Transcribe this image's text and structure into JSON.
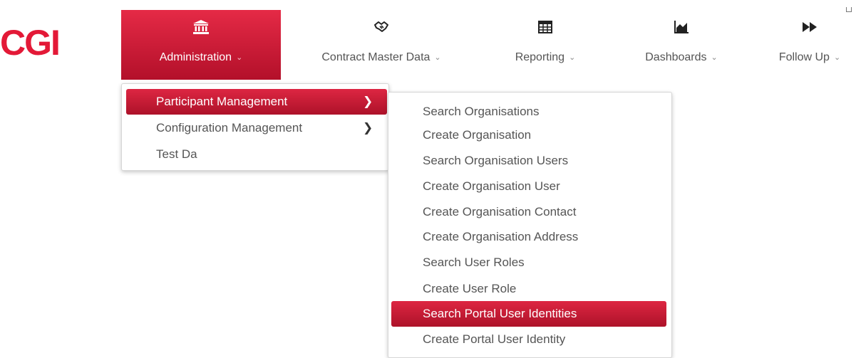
{
  "brand": {
    "logo_text": "CGI",
    "color": "#e31937"
  },
  "accent_color": "#c41e3a",
  "nav": {
    "items": [
      {
        "id": "administration",
        "label": "Administration",
        "icon": "bank-icon",
        "active": true
      },
      {
        "id": "contract-master-data",
        "label": "Contract Master Data",
        "icon": "handshake-icon",
        "active": false
      },
      {
        "id": "reporting",
        "label": "Reporting",
        "icon": "table-grid-icon",
        "active": false
      },
      {
        "id": "dashboards",
        "label": "Dashboards",
        "icon": "area-chart-icon",
        "active": false
      },
      {
        "id": "follow-up",
        "label": "Follow Up",
        "icon": "fast-forward-icon",
        "active": false
      }
    ],
    "caret_glyph": "⌄"
  },
  "menu_level1": {
    "items": [
      {
        "label": "Participant Management",
        "has_submenu": true,
        "active": true
      },
      {
        "label": "Configuration Management",
        "has_submenu": true,
        "active": false
      },
      {
        "label": "Test Da",
        "has_submenu": false,
        "active": false
      }
    ],
    "chevron_glyph": "❯"
  },
  "menu_level2": {
    "items": [
      {
        "label": "Search Organisations",
        "active": false
      },
      {
        "label": "Create Organisation",
        "active": false
      },
      {
        "label": "Search Organisation Users",
        "active": false
      },
      {
        "label": "Create Organisation User",
        "active": false
      },
      {
        "label": "Create Organisation Contact",
        "active": false
      },
      {
        "label": "Create Organisation Address",
        "active": false
      },
      {
        "label": "Search User Roles",
        "active": false
      },
      {
        "label": "Create User Role",
        "active": false
      },
      {
        "label": "Search Portal User Identities",
        "active": true
      },
      {
        "label": "Create Portal User Identity",
        "active": false
      }
    ]
  }
}
